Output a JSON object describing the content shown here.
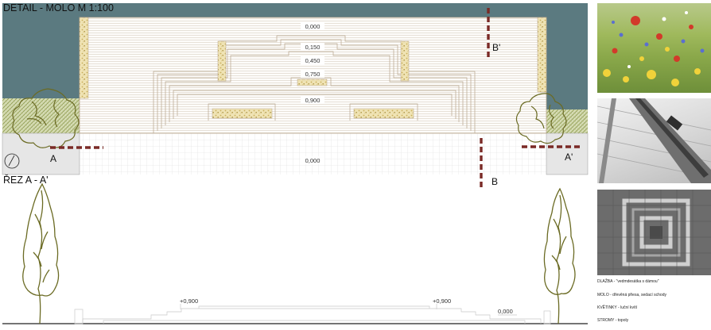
{
  "titles": {
    "detail": "DETAIL - MOLO M 1:100",
    "section": "ŘEZ A - A'"
  },
  "plan_labels": {
    "level_top": "0,000",
    "level_150": "0,150",
    "level_450": "0,450",
    "level_750": "0,750",
    "level_900": "0,900",
    "level_bottom": "0,000",
    "cut_a": "A",
    "cut_a_prime": "A'",
    "cut_b": "B",
    "cut_b_prime": "B'"
  },
  "section_labels": {
    "level_left": "+0,900",
    "level_right": "+0,900",
    "level_ground": "0,000"
  },
  "legend": {
    "paving": "DLAŽBA - \"vedmdesátka s dámou\"",
    "pier": "MOLO - dřevěná přiesa, sedací schody",
    "flowers": "KVĚTINKY - luční kvítí",
    "trees": "STROMY - topoly"
  },
  "colors": {
    "water": "#5b7a80",
    "deck_stroke": "#bba78f",
    "gravel": "#d8c78f",
    "green_hatch": "#aab572",
    "tree": "#6b6b24",
    "cut_line": "#7a2a26"
  },
  "icons": [
    "north-arrow-icon"
  ]
}
